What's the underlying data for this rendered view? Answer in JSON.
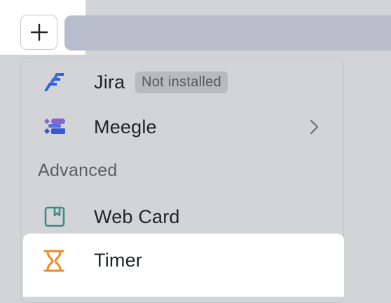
{
  "toolbar": {
    "add_icon": "plus-icon"
  },
  "menu": {
    "items": [
      {
        "label": "Jira",
        "badge": "Not installed",
        "icon": "jira-icon"
      },
      {
        "label": "Meegle",
        "icon": "meegle-icon",
        "has_submenu": true
      },
      {
        "label": "Web Card",
        "icon": "web-card-icon"
      }
    ],
    "section_heading": "Advanced",
    "highlighted_item": {
      "label": "Timer",
      "icon": "hourglass-icon"
    }
  },
  "colors": {
    "jira_blue": "#2b5fd9",
    "meegle_purple": "#8a63d2",
    "webcard_teal": "#3b8c88",
    "timer_orange": "#f08a24"
  }
}
